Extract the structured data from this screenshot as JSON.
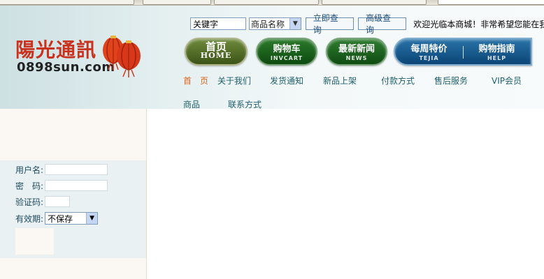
{
  "search": {
    "keyword_value": "关键字",
    "field_select": "商品名称",
    "submit_label": "立即查询",
    "advanced_label": "高级查询",
    "marquee_text": "欢迎光临本商城！非常希望您能在我们商城"
  },
  "logo": {
    "name_cn": "陽光通訊",
    "domain": "0898sun.com"
  },
  "nav": {
    "home_main": "首页",
    "home_sub": "HOME",
    "cart_main": "购物车",
    "cart_sub": "INVCART",
    "news_main": "最新新闻",
    "news_sub": "NEWS",
    "special_main": "每周特价",
    "special_sub": "TEJIA",
    "guide_main": "购物指南",
    "guide_sub": "HELP"
  },
  "subnav": {
    "items": [
      "首　页",
      "关于我们",
      "发货通知",
      "新品上架",
      "付款方式",
      "售后服务",
      "VIP会员"
    ],
    "row2": [
      "商品",
      "联系方式"
    ]
  },
  "login": {
    "username_label": "用户名:",
    "password_label": "密　码:",
    "captcha_label": "验证码:",
    "expiry_label": "有效期:",
    "expiry_value": "不保存"
  },
  "colors": {
    "current_nav": "#d9651a",
    "nav_text": "#1f5f6a",
    "logo_red": "#c8321e"
  }
}
